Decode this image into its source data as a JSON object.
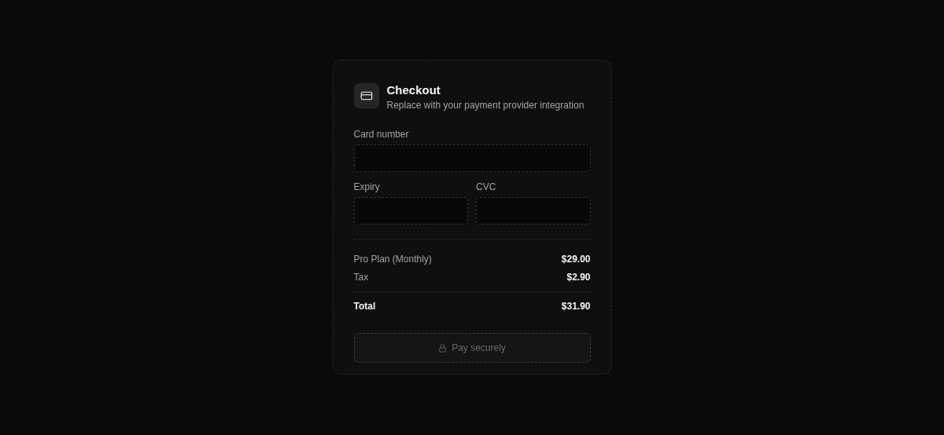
{
  "checkout": {
    "title": "Checkout",
    "subtitle": "Replace with your payment provider integration",
    "card_field": {
      "label": "Card number"
    },
    "split_fields": [
      {
        "label": "Expiry"
      },
      {
        "label": "CVC"
      }
    ],
    "lines": [
      {
        "label": "Pro Plan (Monthly)",
        "amount": "$29.00"
      },
      {
        "label": "Tax",
        "amount": "$2.90"
      }
    ],
    "total": {
      "label": "Total",
      "amount": "$31.90"
    },
    "pay_button": {
      "label": "Pay securely",
      "disabled": true
    }
  }
}
